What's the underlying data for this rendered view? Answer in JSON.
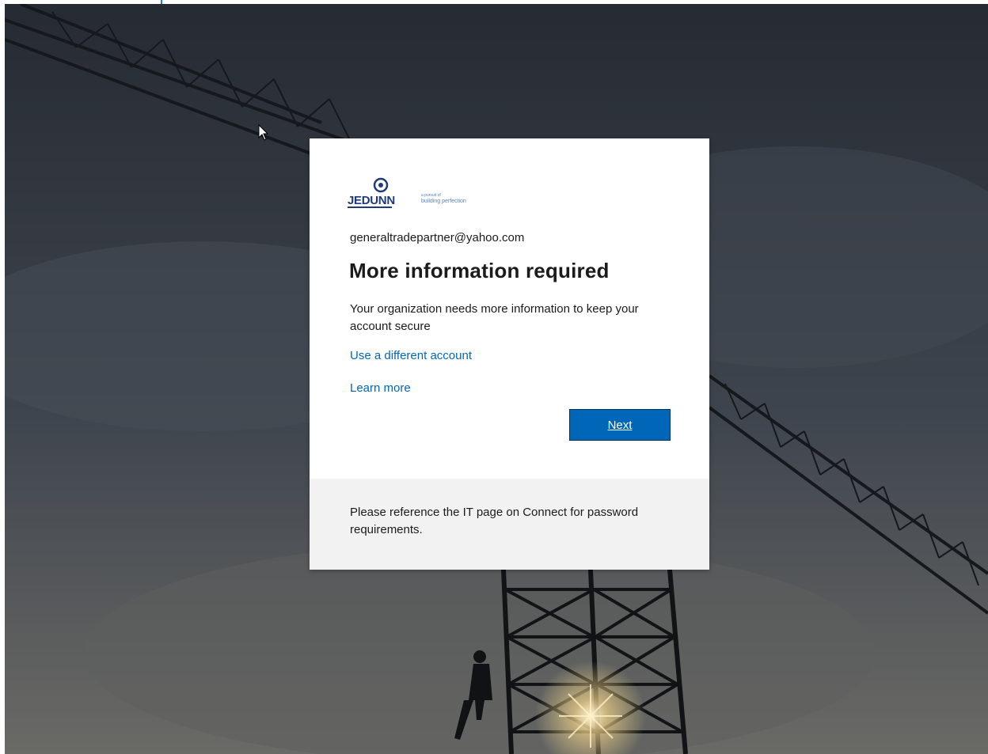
{
  "logo": {
    "brand": "JEDUNN",
    "tagline_small": "a pursuit of",
    "tagline": "building perfection"
  },
  "account": {
    "email": "generaltradepartner@yahoo.com"
  },
  "dialog": {
    "title": "More information required",
    "description": "Your organization needs more information to keep your account secure",
    "use_different_account": "Use a different account",
    "learn_more": "Learn more",
    "next_label": "Next"
  },
  "footer": {
    "text": "Please reference the IT page on Connect for password requirements."
  },
  "colors": {
    "accent": "#0067b8",
    "footer_bg": "#f2f2f2",
    "brand_blue": "#1f3b7a"
  }
}
